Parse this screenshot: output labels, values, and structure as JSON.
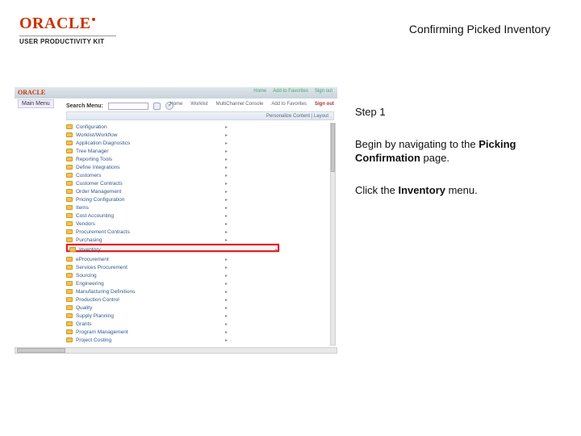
{
  "header": {
    "logo_brand": "ORACLE",
    "logo_subtitle": "USER PRODUCTIVITY KIT",
    "page_title": "Confirming Picked Inventory"
  },
  "instruction": {
    "step_label": "Step 1",
    "line1_a": "Begin by navigating to the ",
    "line1_b": "Picking Confirmation",
    "line1_c": " page.",
    "line2_a": "Click the ",
    "line2_b": "Inventory",
    "line2_c": " menu."
  },
  "screenshot": {
    "top_logo": "ORACLE",
    "main_menu_label": "Main Menu",
    "search_label": "Search Menu:",
    "top_tabs": [
      "Home",
      "Add to Favorites",
      "Sign out"
    ],
    "toolbar": [
      "Home",
      "Worklist",
      "MultiChannel Console",
      "Add to Favorites",
      "Sign out"
    ],
    "subbar_text": "Personalize Content | Layout",
    "nav_items_upper": [
      "Configuration",
      "Worklist/Workflow",
      "Application Diagnostics",
      "Tree Manager",
      "Reporting Tools",
      "Define Integrations",
      "Customers",
      "Customer Contracts",
      "Order Management",
      "Pricing Configuration",
      "Items",
      "Cost Accounting",
      "Vendors",
      "Procurement Contracts",
      "Purchasing"
    ],
    "highlighted_item": "Inventory",
    "nav_items_lower": [
      "eProcurement",
      "Services Procurement",
      "Sourcing",
      "Engineering",
      "Manufacturing Definitions",
      "Production Control",
      "Quality",
      "Supply Planning",
      "Grants",
      "Program Management",
      "Project Costing"
    ]
  }
}
